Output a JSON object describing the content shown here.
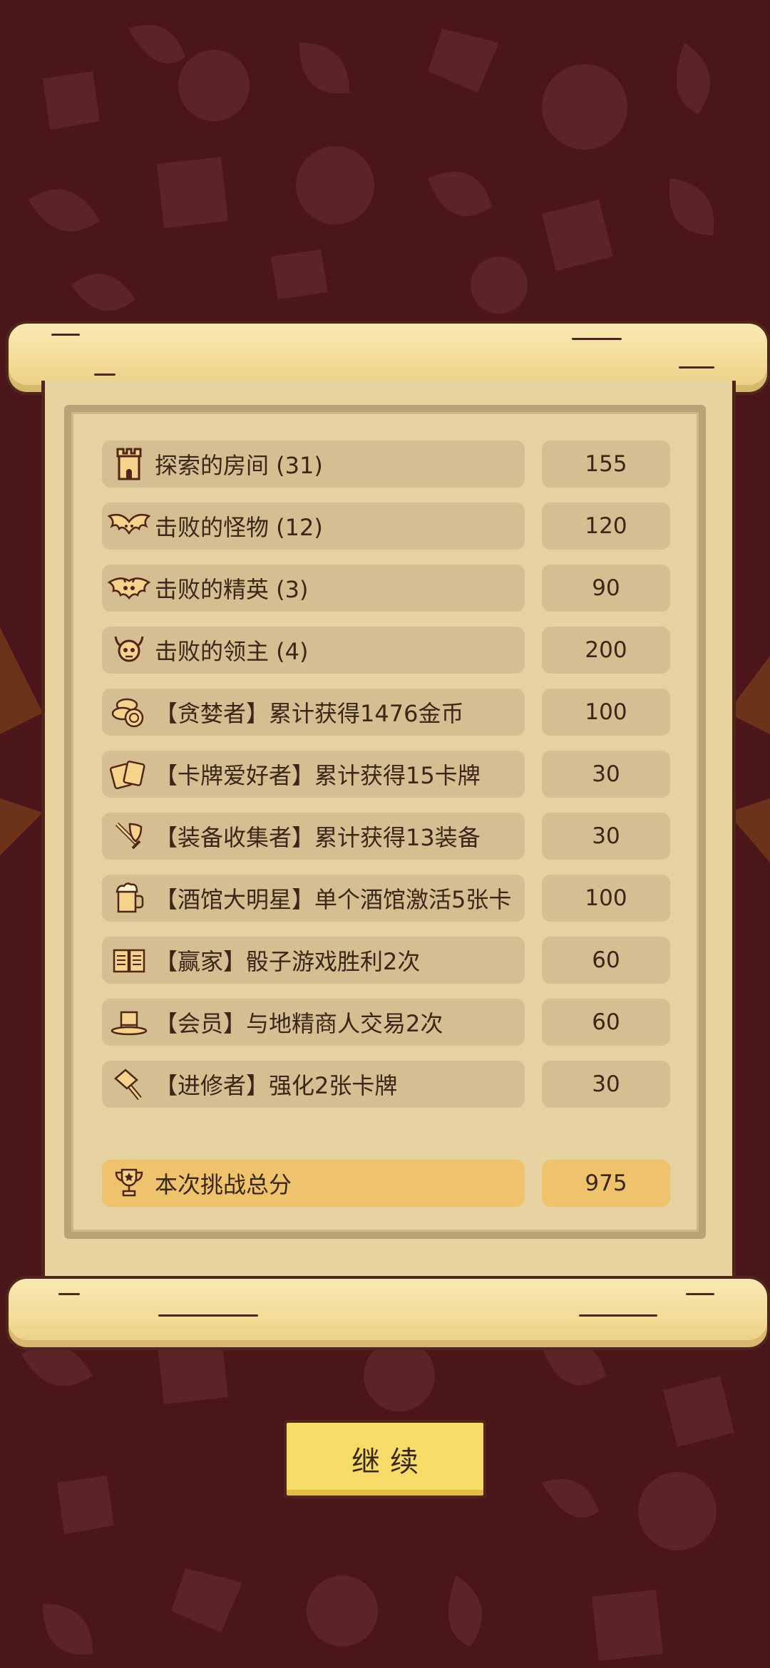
{
  "results": [
    {
      "icon": "tower-icon",
      "label": "探索的房间 (31)",
      "value": "155"
    },
    {
      "icon": "bat-icon",
      "label": "击败的怪物 (12)",
      "value": "120"
    },
    {
      "icon": "demon-bat-icon",
      "label": "击败的精英 (3)",
      "value": "90"
    },
    {
      "icon": "horned-skull-icon",
      "label": "击败的领主 (4)",
      "value": "200"
    },
    {
      "icon": "coins-icon",
      "label": "【贪婪者】累计获得1476金币",
      "value": "100"
    },
    {
      "icon": "cards-icon",
      "label": "【卡牌爱好者】累计获得15卡牌",
      "value": "30"
    },
    {
      "icon": "sword-shield-icon",
      "label": "【装备收集者】累计获得13装备",
      "value": "30"
    },
    {
      "icon": "beer-mug-icon",
      "label": "【酒馆大明星】单个酒馆激活5张卡",
      "value": "100"
    },
    {
      "icon": "open-book-icon",
      "label": "【赢家】骰子游戏胜利2次",
      "value": "60"
    },
    {
      "icon": "top-hat-icon",
      "label": "【会员】与地精商人交易2次",
      "value": "60"
    },
    {
      "icon": "hammer-icon",
      "label": "【进修者】强化2张卡牌",
      "value": "30"
    }
  ],
  "total": {
    "icon": "trophy-icon",
    "label": "本次挑战总分",
    "value": "975"
  },
  "continue_label": "继续",
  "colors": {
    "background": "#4a161a",
    "parchment": "#e7d3a0",
    "row_fill": "#d5be92",
    "total_fill": "#efc36e",
    "button_fill": "#f8dc6a",
    "ink": "#3a2718"
  }
}
